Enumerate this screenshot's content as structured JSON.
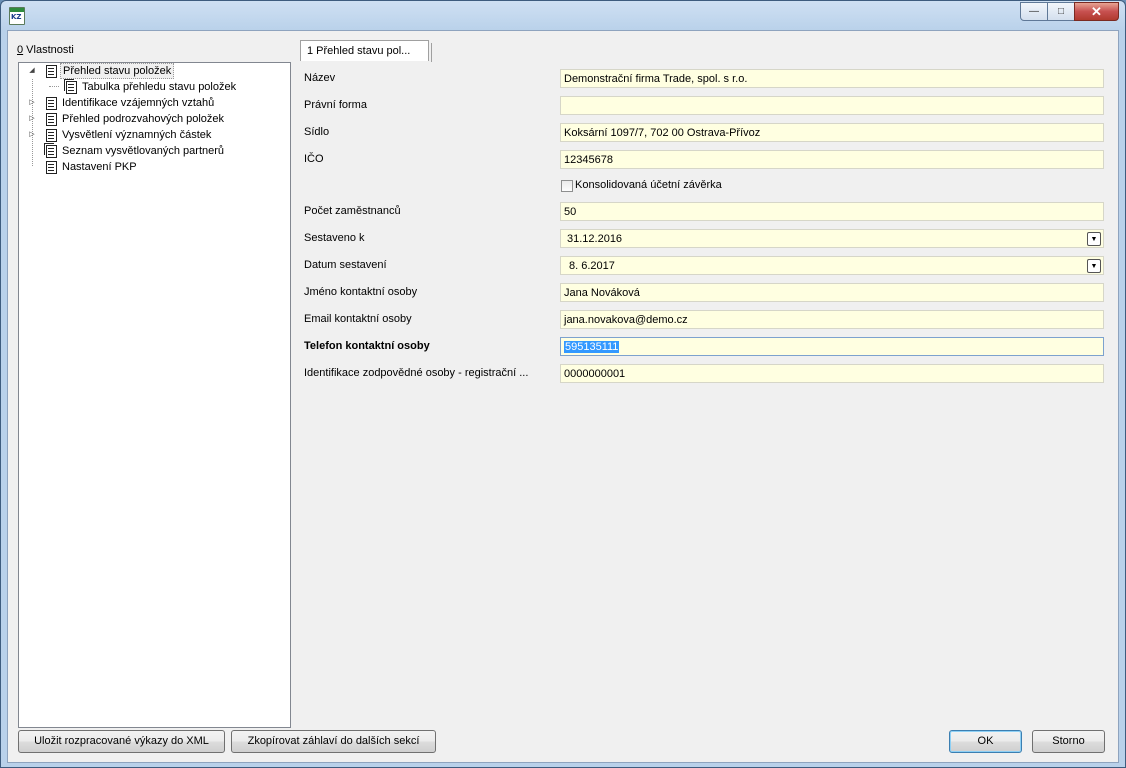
{
  "window": {
    "icon_text": "KZ",
    "minimize_glyph": "—",
    "maximize_glyph": "□",
    "close_glyph": "✕"
  },
  "properties_panel": {
    "label_hotkey": "0",
    "label_rest": " Vlastnosti"
  },
  "tree": {
    "items": [
      {
        "label": "Přehled stavu položek",
        "expander": "◢"
      },
      {
        "label": "Tabulka přehledu stavu položek"
      },
      {
        "label": "Identifikace vzájemných vztahů",
        "expander": "▷"
      },
      {
        "label": "Přehled podrozvahových položek",
        "expander": "▷"
      },
      {
        "label": "Vysvětlení významných částek",
        "expander": "▷"
      },
      {
        "label": "Seznam vysvětlovaných partnerů"
      },
      {
        "label": "Nastavení PKP"
      }
    ]
  },
  "tab": {
    "label": "1 Přehled stavu pol..."
  },
  "form": {
    "fields": [
      {
        "label": "Název",
        "value": "Demonstrační firma Trade, spol. s r.o."
      },
      {
        "label": "Právní forma",
        "value": ""
      },
      {
        "label": "Sídlo",
        "value": "Koksární 1097/7, 702 00 Ostrava-Přívoz"
      },
      {
        "label": "IČO",
        "value": "12345678"
      },
      {
        "label": "Počet zaměstnanců",
        "value": "50"
      },
      {
        "label": "Sestaveno k",
        "value": "31.12.2016"
      },
      {
        "label": "Datum sestavení",
        "value": "8. 6.2017"
      },
      {
        "label": "Jméno kontaktní osoby",
        "value": "Jana Nováková"
      },
      {
        "label": "Email kontaktní osoby",
        "value": "jana.novakova@demo.cz"
      },
      {
        "label": "Telefon kontaktní osoby",
        "value": "595135111"
      },
      {
        "label": "Identifikace zodpovědné osoby - registrační ...",
        "value": "0000000001"
      }
    ],
    "consolidated": {
      "label": "Konsolidovaná účetní závěrka",
      "checked": false
    },
    "dropdown_glyph": "▼"
  },
  "buttons": {
    "save_xml": "Uložit rozpracované výkazy do XML",
    "copy_header": "Zkopírovat záhlaví do dalších sekcí",
    "ok": "OK",
    "cancel": "Storno"
  },
  "colors": {
    "field_background": "#ffffe1",
    "selection": "#3399ff"
  }
}
